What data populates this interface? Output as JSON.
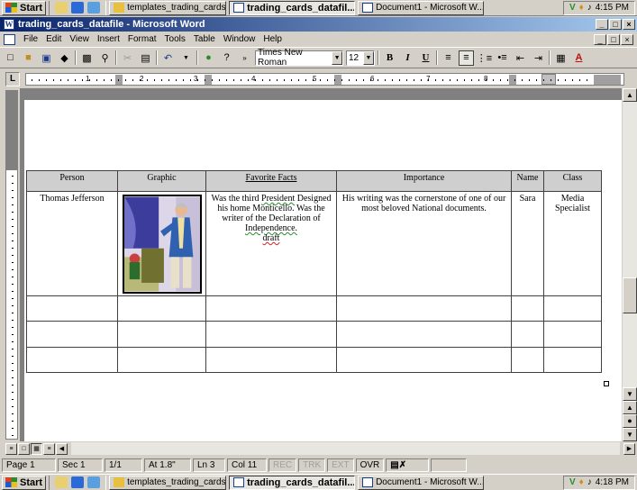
{
  "taskbar_top": {
    "start_label": "Start",
    "tasks": [
      {
        "label": "templates_trading_cards"
      },
      {
        "label": "trading_cards_datafil..."
      },
      {
        "label": "Document1 - Microsoft W..."
      }
    ],
    "clock": "4:15 PM"
  },
  "window": {
    "title": "trading_cards_datafile - Microsoft Word"
  },
  "menu": {
    "items": [
      "File",
      "Edit",
      "View",
      "Insert",
      "Format",
      "Tools",
      "Table",
      "Window",
      "Help"
    ]
  },
  "toolbar": {
    "font_name": "Times New Roman",
    "font_size": "12",
    "bold": "B",
    "italic": "I",
    "underline": "U"
  },
  "ruler": {
    "numbers": [
      "1",
      "2",
      "3",
      "4",
      "5",
      "6",
      "7",
      "8"
    ]
  },
  "table": {
    "headers": [
      "Person",
      "Graphic",
      "Favorite Facts",
      "Importance",
      "Name",
      "Class"
    ],
    "row1": {
      "person": "Thomas Jefferson",
      "graphic_alt": "Thomas Jefferson illustration",
      "facts_pre": "Was the third ",
      "facts_president": "President",
      "facts_mid": " Designed his home Monticello. Was the writer of the Declaration of ",
      "facts_independence": "Independence.",
      "facts_draft": "draft",
      "importance": "His writing was the cornerstone of one of our most beloved National documents.",
      "name": "Sara",
      "class": "Media Specialist"
    }
  },
  "status": {
    "page": "Page 1",
    "sec": "Sec 1",
    "pages": "1/1",
    "at": "At 1.8\"",
    "ln": "Ln 3",
    "col": "Col 11",
    "rec": "REC",
    "trk": "TRK",
    "ext": "EXT",
    "ovr": "OVR"
  },
  "taskbar_bottom": {
    "start_label": "Start",
    "tasks": [
      {
        "label": "templates_trading_cards"
      },
      {
        "label": "trading_cards_datafil..."
      },
      {
        "label": "Document1 - Microsoft W..."
      }
    ],
    "clock": "4:18 PM"
  },
  "colors": {
    "titlebar_start": "#0a246a",
    "titlebar_end": "#a6caf0",
    "header_cell": "#cfcfcf",
    "spelling_underline": "#d02020"
  }
}
